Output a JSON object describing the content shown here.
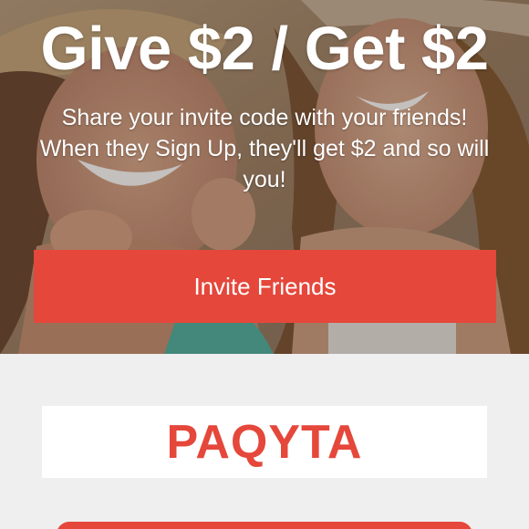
{
  "hero": {
    "headline": "Give $2 / Get $2",
    "subtext": "Share your invite code with your friends! When they Sign Up, they'll get $2 and so will you!",
    "invite_button_label": "Invite Friends"
  },
  "code_section": {
    "invite_code": "PAQYTA"
  },
  "colors": {
    "accent": "#e5473b",
    "background": "#efefef",
    "code_box": "#ffffff"
  }
}
